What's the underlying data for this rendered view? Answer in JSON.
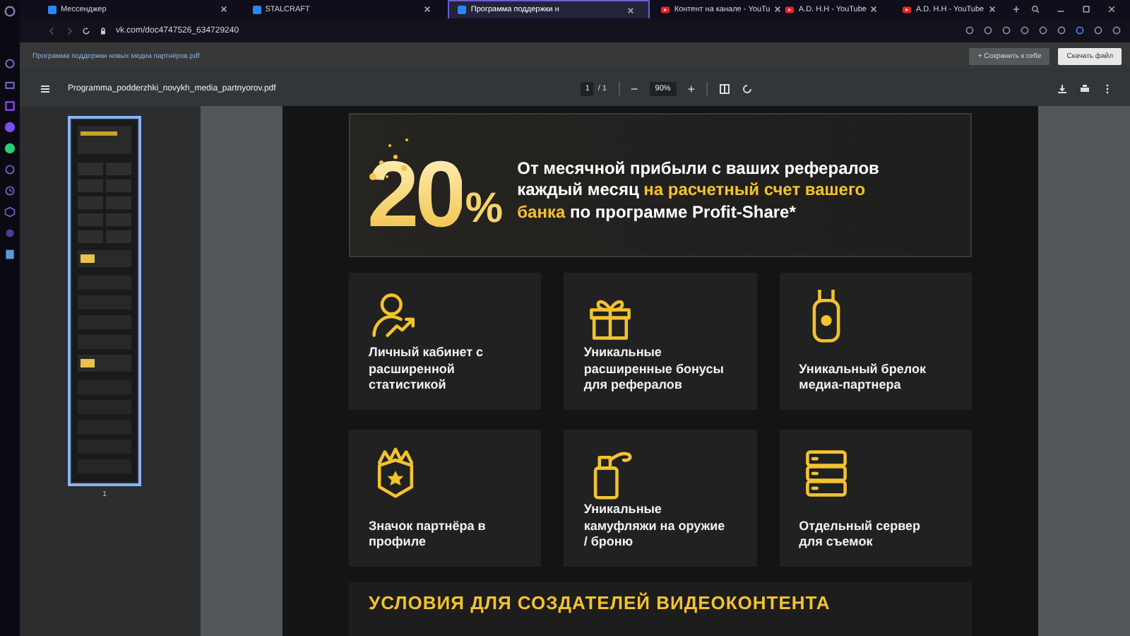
{
  "tabs": [
    {
      "label": "Мессенджер",
      "kind": "site",
      "selected": false
    },
    {
      "label": "STALCRAFT",
      "kind": "site",
      "selected": false
    },
    {
      "label": "Программа поддержки н",
      "kind": "site",
      "selected": true
    },
    {
      "label": "Контент на канале - YouTu",
      "kind": "video",
      "selected": false
    },
    {
      "label": "A.D. H.H - YouTube",
      "kind": "video",
      "selected": false
    },
    {
      "label": "A.D. H.H - YouTube",
      "kind": "video",
      "selected": false
    }
  ],
  "address": "vk.com/doc4747526_634729240",
  "doc_bar": {
    "link": "Программа поддержки новых медиа партнёров.pdf",
    "buttons": [
      {
        "label": "+ Сохранить к себе",
        "kind": "secondary"
      },
      {
        "label": "Скачать файл",
        "kind": "primary"
      }
    ]
  },
  "pdf_toolbar": {
    "filename": "Programma_podderzhki_novykh_media_partnyorov.pdf",
    "page": "1",
    "pages": "/ 1",
    "zoom_out": "−",
    "zoom": "90%",
    "zoom_in": "+"
  },
  "thumbnails": [
    {
      "label": "1",
      "selected": true
    }
  ],
  "banner": {
    "number": "20",
    "unit": "%",
    "text": [
      {
        "text": "От месячной прибыли с ваших рефералов каждый месяц ",
        "highlight": false
      },
      {
        "text": "на расчетный счет вашего банка",
        "highlight": true
      },
      {
        "text": " по программе Profit-Share*",
        "highlight": false
      }
    ]
  },
  "cards": [
    {
      "label": "Личный кабинет с расширенной статистикой",
      "kind": "person"
    },
    {
      "label": "Уникальные расширенные бонусы для рефералов",
      "kind": "gift"
    },
    {
      "label": "Уникальный брелок медиа-партнера",
      "kind": "tag"
    },
    {
      "label": "Значок партнёра в профиле",
      "kind": "badge"
    },
    {
      "label": "Уникальные камуфляжи на оружие / броню",
      "kind": "spray"
    },
    {
      "label": "Отдельный сервер для съемок",
      "kind": "server"
    }
  ],
  "section_heading": "УСЛОВИЯ ДЛЯ СОЗДАТЕЛЕЙ ВИДЕОКОНТЕНТА"
}
